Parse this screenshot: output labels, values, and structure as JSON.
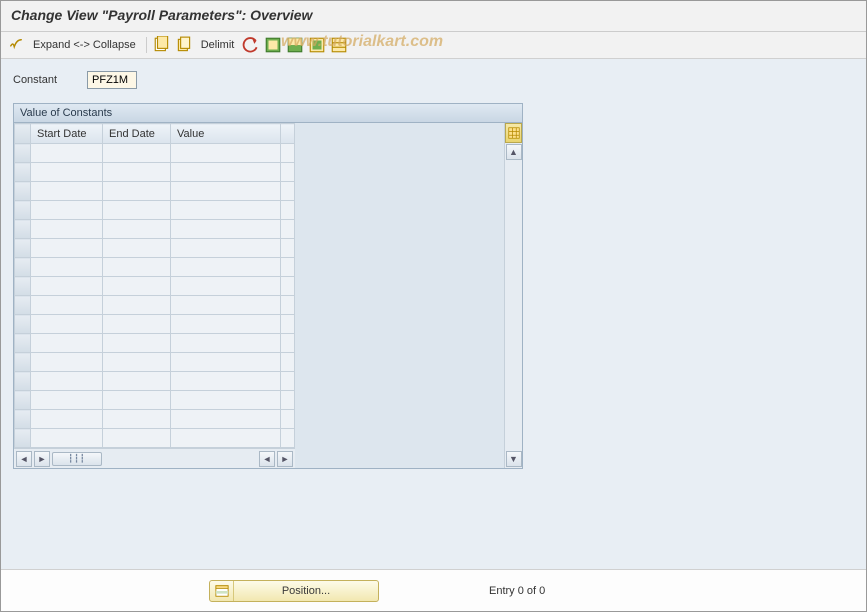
{
  "header": {
    "title": "Change View \"Payroll Parameters\": Overview"
  },
  "toolbar": {
    "expand_collapse_label": "Expand <-> Collapse",
    "delimit_label": "Delimit"
  },
  "watermark": "www.tutorialkart.com",
  "form": {
    "constant_label": "Constant",
    "constant_value": "PFZ1M"
  },
  "panel": {
    "title": "Value of Constants",
    "columns": {
      "start_date": "Start Date",
      "end_date": "End Date",
      "value": "Value"
    },
    "rows_visible": 16
  },
  "footer": {
    "position_label": "Position...",
    "entry_status": "Entry 0 of 0"
  }
}
